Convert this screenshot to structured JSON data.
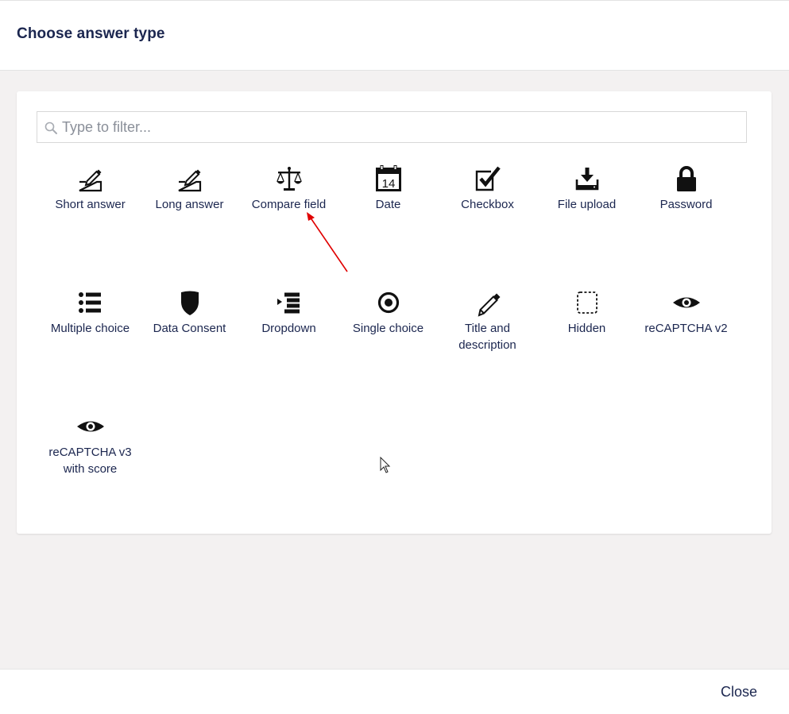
{
  "dialog": {
    "title": "Choose answer type"
  },
  "filter": {
    "placeholder": "Type to filter...",
    "value": ""
  },
  "answer_types": [
    {
      "label": "Short answer",
      "icon": "pencil-field-icon"
    },
    {
      "label": "Long answer",
      "icon": "pencil-field-icon"
    },
    {
      "label": "Compare field",
      "icon": "scales-icon"
    },
    {
      "label": "Date",
      "icon": "calendar-icon",
      "icon_text": "14"
    },
    {
      "label": "Checkbox",
      "icon": "checkbox-icon"
    },
    {
      "label": "File upload",
      "icon": "upload-icon"
    },
    {
      "label": "Password",
      "icon": "lock-icon"
    },
    {
      "label": "Multiple choice",
      "icon": "list-icon"
    },
    {
      "label": "Data Consent",
      "icon": "shield-icon"
    },
    {
      "label": "Dropdown",
      "icon": "dropdown-list-icon"
    },
    {
      "label": "Single choice",
      "icon": "radio-icon"
    },
    {
      "label": "Title and description",
      "icon": "pencil-icon"
    },
    {
      "label": "Hidden",
      "icon": "dashed-box-icon"
    },
    {
      "label": "reCAPTCHA v2",
      "icon": "eye-icon"
    },
    {
      "label": "reCAPTCHA v3 with score",
      "icon": "eye-icon"
    }
  ],
  "footer": {
    "close_label": "Close"
  },
  "colors": {
    "text": "#1b264f",
    "background": "#f3f1f1",
    "annotation_arrow": "#e00000"
  }
}
